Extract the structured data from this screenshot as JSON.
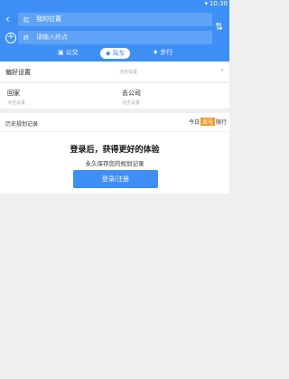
{
  "status_bar": {
    "time": "10:30"
  },
  "route": {
    "start": {
      "badge": "起",
      "value": "我的位置"
    },
    "end": {
      "badge": "终",
      "placeholder": "请输入终点"
    },
    "modes": [
      {
        "label": "公交"
      },
      {
        "label": "驾车"
      },
      {
        "label": "步行"
      }
    ],
    "active_mode": "驾车"
  },
  "preferences": {
    "label": "偏好设置",
    "hint": "点击设置"
  },
  "places": {
    "home": {
      "name": "回家",
      "sub": "点击设置"
    },
    "company": {
      "name": "去公司",
      "sub": "点击设置"
    }
  },
  "history": {
    "label": "历史规划记录",
    "limit_prefix": "今日",
    "limit_plate": "单号",
    "limit_suffix": "限行"
  },
  "login_panel": {
    "title": "登录后，获得更好的体验",
    "subtitle": "永久保存您的规划记录",
    "button": "登录/注册"
  },
  "colors": {
    "primary": "#3d8ff5",
    "accent": "#f29a2e"
  }
}
